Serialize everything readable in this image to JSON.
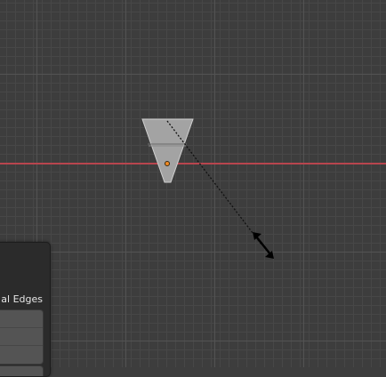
{
  "viewport": {
    "background": "#3d3d3d",
    "grid_minor_color": "#474747",
    "grid_major_color": "#535353",
    "x_axis_color": "#b8454e"
  },
  "mesh": {
    "fill": "#a3a3a3",
    "edge": "#c9c9c9",
    "origin_color": "#f08a24"
  },
  "cursor": {
    "icon": "bidirectional-resize-arrow"
  },
  "operator_panel": {
    "label": "al Edges"
  }
}
